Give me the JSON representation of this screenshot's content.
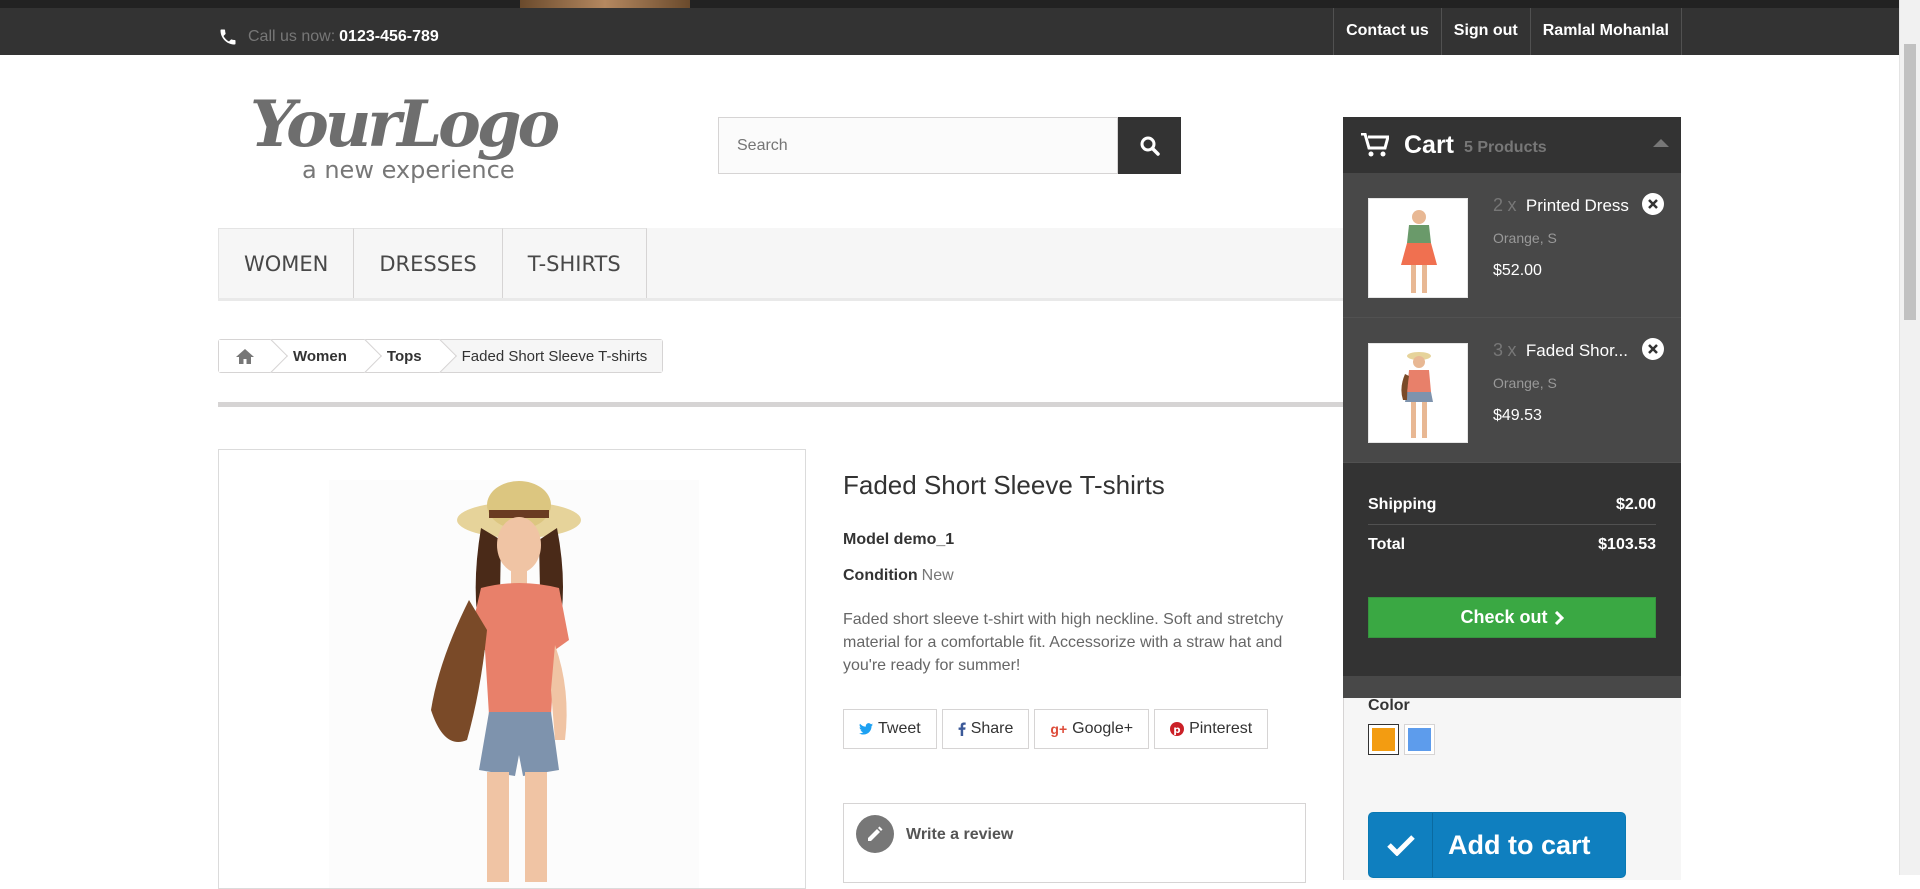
{
  "header": {
    "call_prefix": "Call us now:",
    "phone": "0123-456-789",
    "links": [
      "Contact us",
      "Sign out",
      "Ramlal Mohanlal"
    ]
  },
  "logo": {
    "main": "YourLogo",
    "tagline": "a new experience"
  },
  "search": {
    "placeholder": "Search"
  },
  "menu": [
    "WOMEN",
    "DRESSES",
    "T-SHIRTS"
  ],
  "breadcrumb": {
    "items": [
      "Women",
      "Tops"
    ],
    "current": "Faded Short Sleeve T-shirts"
  },
  "product": {
    "title": "Faded Short Sleeve T-shirts",
    "model_label": "Model",
    "model_value": "demo_1",
    "condition_label": "Condition",
    "condition_value": "New",
    "description": "Faded short sleeve t-shirt with high neckline. Soft and stretchy material for a comfortable fit. Accessorize with a straw hat and you're ready for summer!",
    "social": [
      "Tweet",
      "Share",
      "Google+",
      "Pinterest"
    ],
    "review": "Write a review",
    "color_label": "Color",
    "colors": [
      "#f39c11",
      "#5d9cec"
    ],
    "add_to_cart": "Add to cart"
  },
  "cart": {
    "title": "Cart",
    "count": "5 Products",
    "items": [
      {
        "qty": "2",
        "x": "x",
        "name": "Printed Dress",
        "attr": "Orange, S",
        "price": "$52.00"
      },
      {
        "qty": "3",
        "x": "x",
        "name": "Faded Shor...",
        "attr": "Orange, S",
        "price": "$49.53"
      }
    ],
    "shipping_label": "Shipping",
    "shipping_value": "$2.00",
    "total_label": "Total",
    "total_value": "$103.53",
    "checkout": "Check out"
  }
}
